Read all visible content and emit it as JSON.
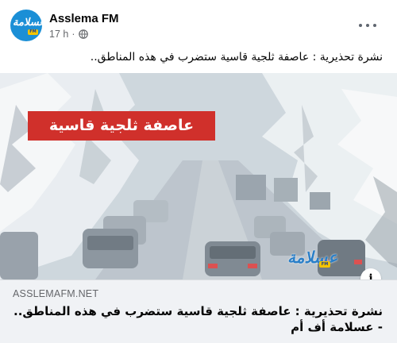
{
  "post": {
    "page_name": "Asslema FM",
    "time": "17 h",
    "separator": "·",
    "privacy_icon": "globe-icon",
    "more_icon": "more-horizontal-icon",
    "caption": "نشرة تحذيرية : عاصفة ثلجية قاسية ستضرب في هذه المناطق..",
    "avatar_text": "عسلامة",
    "avatar_badge": "FM"
  },
  "image": {
    "banner_text": "عاصفة ثلجية قاسية",
    "watermark_text": "عسلامة",
    "watermark_badge": "FM",
    "info_icon": "info-icon",
    "info_label": "i"
  },
  "link": {
    "domain": "ASSLEMAFM.NET",
    "title": "نشرة تحذيرية : عاصفة ثلجية قاسية ستضرب في هذه المناطق.. - عسلامة أف أم"
  },
  "colors": {
    "banner_red": "#d0302b",
    "brand_blue": "#1b8fd6",
    "brand_yellow": "#f4c400",
    "link_bg": "#f0f2f5",
    "meta_gray": "#65676b"
  }
}
